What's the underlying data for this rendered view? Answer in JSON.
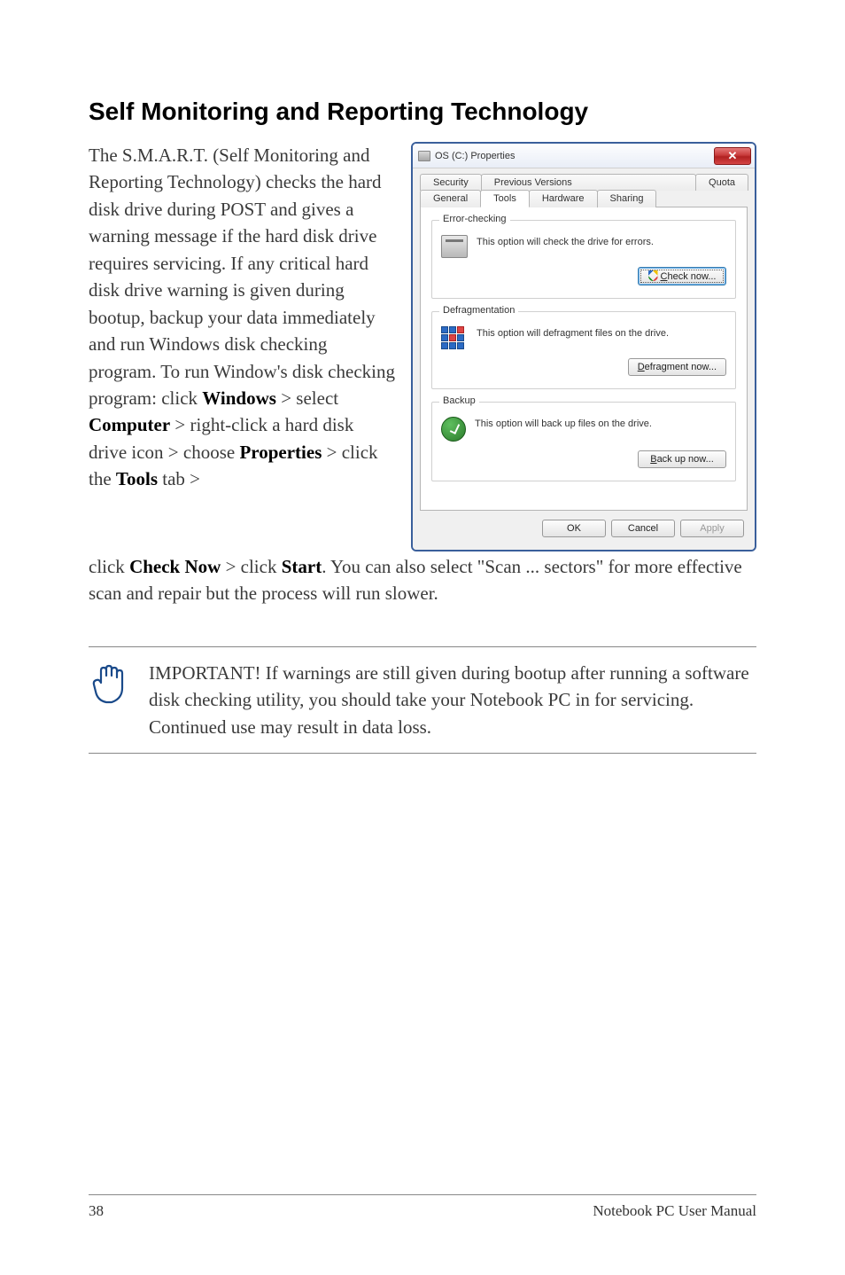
{
  "heading": "Self Monitoring and Reporting Technology",
  "para1_a": "The S.M.A.R.T. (Self Monitoring and Reporting Technology) checks the hard disk drive during POST and gives a warning message if the hard disk drive requires servicing. If any critical hard disk drive warning is given during bootup, backup your data immediately and run Windows disk checking program. To run Window's disk checking program: click ",
  "b1": "Windows",
  "s1": " > select ",
  "b2": "Computer",
  "s2": " > right-click a hard disk drive icon > choose ",
  "b3": "Properties",
  "s3": " > click the ",
  "b4": "Tools",
  "s4": " tab > ",
  "cont_a": "click ",
  "b5": "Check Now",
  "cont_b": " > click ",
  "b6": "Start",
  "cont_c": ". You can also select \"Scan ... sectors\" for more effective scan and repair but the process will run slower.",
  "dialog": {
    "title": "OS (C:) Properties",
    "close": "✕",
    "tabs_row1": [
      "Security",
      "Previous Versions",
      "Quota"
    ],
    "tabs_row2": [
      "General",
      "Tools",
      "Hardware",
      "Sharing"
    ],
    "error_legend": "Error-checking",
    "error_text": "This option will check the drive for errors.",
    "check_btn_pre": "C",
    "check_btn_rest": "heck now...",
    "defrag_legend": "Defragmentation",
    "defrag_text": "This option will defragment files on the drive.",
    "defrag_btn_pre": "D",
    "defrag_btn_rest": "efragment now...",
    "backup_legend": "Backup",
    "backup_text": "This option will back up files on the drive.",
    "backup_btn_pre": "B",
    "backup_btn_rest": "ack up now...",
    "ok": "OK",
    "cancel": "Cancel",
    "apply": "Apply"
  },
  "note": "IMPORTANT! If warnings are still given during bootup after running a software disk checking utility, you should take your Notebook PC in for servicing. Continued use may result in data loss.",
  "footer": {
    "page": "38",
    "label": "Notebook PC User Manual"
  }
}
